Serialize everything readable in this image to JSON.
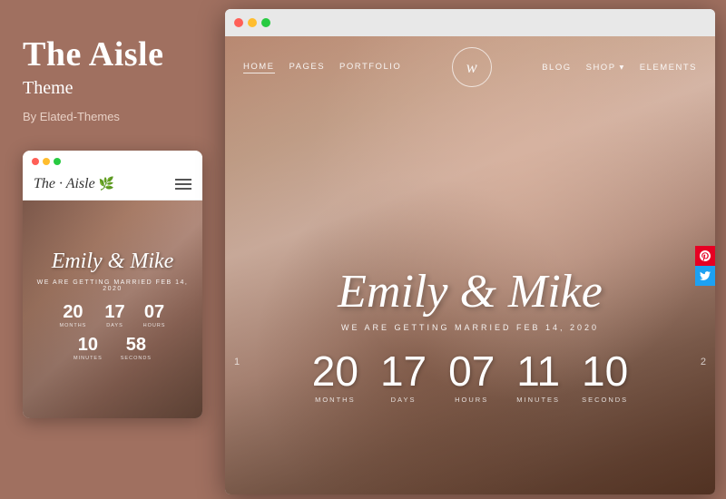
{
  "left": {
    "title": "The Aisle",
    "subtitle": "Theme",
    "author": "By Elated-Themes"
  },
  "mobile": {
    "dots": [
      "red",
      "yellow",
      "green"
    ],
    "logo": "The · Aisle",
    "couple_name": "Emily & Mike",
    "tagline": "WE ARE GETTING MARRIED FEB 14, 2020",
    "countdown": [
      {
        "num": "20",
        "label": "MONTHS"
      },
      {
        "num": "17",
        "label": "DAYS"
      },
      {
        "num": "07",
        "label": "HOURS"
      }
    ],
    "countdown2": [
      {
        "num": "10",
        "label": "MINUTES"
      },
      {
        "num": "58",
        "label": "SECONDS"
      }
    ]
  },
  "desktop": {
    "nav_links_left": [
      "HOME",
      "PAGES",
      "PORTFOLIO"
    ],
    "nav_links_right": [
      "BLOG",
      "SHOP",
      "ELEMENTS"
    ],
    "logo_letter": "w",
    "couple_name": "Emily & Mike",
    "tagline": "WE ARE GETTING MARRIED FEB 14, 2020",
    "countdown": [
      {
        "num": "20",
        "label": "MONTHS"
      },
      {
        "num": "17",
        "label": "DAYS"
      },
      {
        "num": "07",
        "label": "HOURS"
      },
      {
        "num": "11",
        "label": "MINUTES"
      },
      {
        "num": "10",
        "label": "SECONDS"
      }
    ],
    "page_left": "1",
    "page_right": "2",
    "social": [
      "P",
      "t"
    ]
  }
}
